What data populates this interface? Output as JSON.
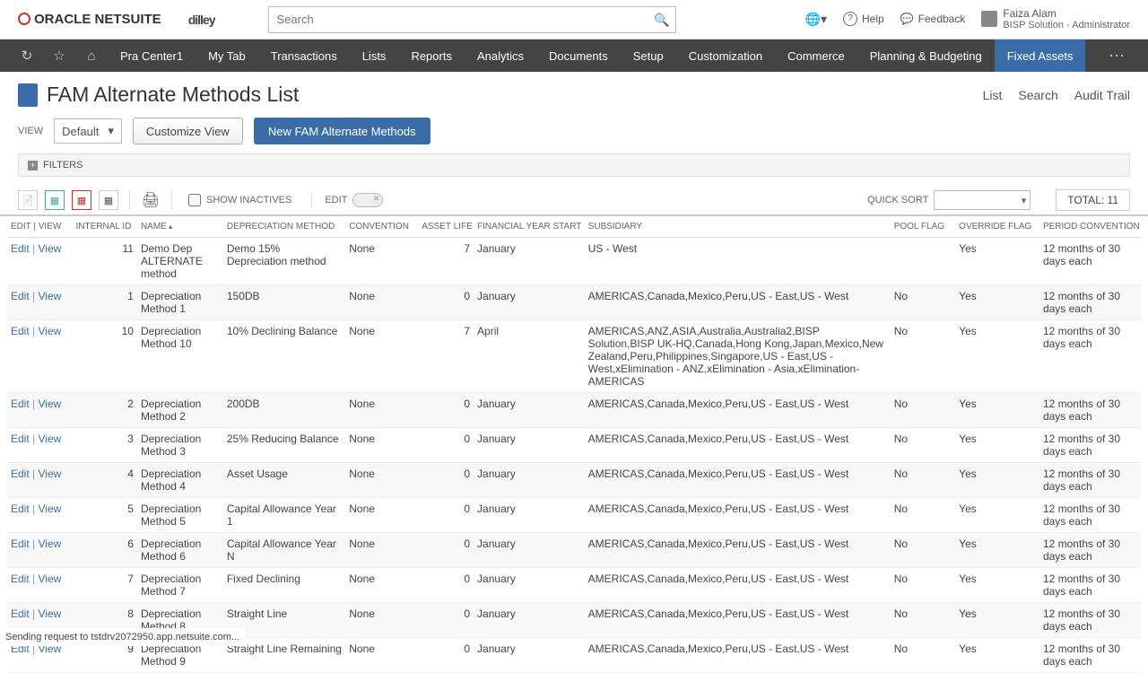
{
  "header": {
    "logo_main": "ORACLE NETSUITE",
    "logo_secondary": "dilley",
    "search_placeholder": "Search",
    "help_label": "Help",
    "feedback_label": "Feedback",
    "user_name": "Faiza Alam",
    "user_role": "BISP Solution - Administrator"
  },
  "nav": {
    "items": [
      "Pra Center1",
      "My Tab",
      "Transactions",
      "Lists",
      "Reports",
      "Analytics",
      "Documents",
      "Setup",
      "Customization",
      "Commerce",
      "Planning & Budgeting",
      "Fixed Assets"
    ],
    "active_index": 11
  },
  "page": {
    "title": "FAM Alternate Methods List",
    "right_links": [
      "List",
      "Search",
      "Audit Trail"
    ]
  },
  "controls": {
    "view_label": "VIEW",
    "view_value": "Default",
    "customize_label": "Customize View",
    "new_label": "New FAM Alternate Methods"
  },
  "filters": {
    "label": "FILTERS"
  },
  "toolbar": {
    "show_inactives_label": "SHOW INACTIVES",
    "edit_label": "EDIT",
    "quick_sort_label": "QUICK SORT",
    "total_label": "TOTAL: 11"
  },
  "table": {
    "columns": [
      "EDIT | VIEW",
      "INTERNAL ID",
      "NAME",
      "DEPRECIATION METHOD",
      "CONVENTION",
      "ASSET LIFE",
      "FINANCIAL YEAR START",
      "SUBSIDIARY",
      "POOL FLAG",
      "OVERRIDE FLAG",
      "PERIOD CONVENTION"
    ],
    "edit_label": "Edit",
    "view_label": "View",
    "rows": [
      {
        "id": "11",
        "name": "Demo Dep ALTERNATE method",
        "dep": "Demo 15% Depreciation method",
        "conv": "None",
        "life": "7",
        "fys": "January",
        "sub": "US - West",
        "pool": "",
        "over": "Yes",
        "per": "12 months of 30 days each"
      },
      {
        "id": "1",
        "name": "Depreciation Method 1",
        "dep": "150DB",
        "conv": "None",
        "life": "0",
        "fys": "January",
        "sub": "AMERICAS,Canada,Mexico,Peru,US - East,US - West",
        "pool": "No",
        "over": "Yes",
        "per": "12 months of 30 days each"
      },
      {
        "id": "10",
        "name": "Depreciation Method 10",
        "dep": "10% Declining Balance",
        "conv": "None",
        "life": "7",
        "fys": "April",
        "sub": "AMERICAS,ANZ,ASIA,Australia,Australia2,BISP Solution,BISP UK-HQ,Canada,Hong Kong,Japan,Mexico,New Zealand,Peru,Philippines,Singapore,US - East,US - West,xElimination - ANZ,xElimination - Asia,xElimination-AMERICAS",
        "pool": "No",
        "over": "Yes",
        "per": "12 months of 30 days each"
      },
      {
        "id": "2",
        "name": "Depreciation Method 2",
        "dep": "200DB",
        "conv": "None",
        "life": "0",
        "fys": "January",
        "sub": "AMERICAS,Canada,Mexico,Peru,US - East,US - West",
        "pool": "No",
        "over": "Yes",
        "per": "12 months of 30 days each"
      },
      {
        "id": "3",
        "name": "Depreciation Method 3",
        "dep": "25% Reducing Balance",
        "conv": "None",
        "life": "0",
        "fys": "January",
        "sub": "AMERICAS,Canada,Mexico,Peru,US - East,US - West",
        "pool": "No",
        "over": "Yes",
        "per": "12 months of 30 days each"
      },
      {
        "id": "4",
        "name": "Depreciation Method 4",
        "dep": "Asset Usage",
        "conv": "None",
        "life": "0",
        "fys": "January",
        "sub": "AMERICAS,Canada,Mexico,Peru,US - East,US - West",
        "pool": "No",
        "over": "Yes",
        "per": "12 months of 30 days each"
      },
      {
        "id": "5",
        "name": "Depreciation Method 5",
        "dep": "Capital Allowance Year 1",
        "conv": "None",
        "life": "0",
        "fys": "January",
        "sub": "AMERICAS,Canada,Mexico,Peru,US - East,US - West",
        "pool": "No",
        "over": "Yes",
        "per": "12 months of 30 days each"
      },
      {
        "id": "6",
        "name": "Depreciation Method 6",
        "dep": "Capital Allowance Year N",
        "conv": "None",
        "life": "0",
        "fys": "January",
        "sub": "AMERICAS,Canada,Mexico,Peru,US - East,US - West",
        "pool": "No",
        "over": "Yes",
        "per": "12 months of 30 days each"
      },
      {
        "id": "7",
        "name": "Depreciation Method 7",
        "dep": "Fixed Declining",
        "conv": "None",
        "life": "0",
        "fys": "January",
        "sub": "AMERICAS,Canada,Mexico,Peru,US - East,US - West",
        "pool": "No",
        "over": "Yes",
        "per": "12 months of 30 days each"
      },
      {
        "id": "8",
        "name": "Depreciation Method 8",
        "dep": "Straight Line",
        "conv": "None",
        "life": "0",
        "fys": "January",
        "sub": "AMERICAS,Canada,Mexico,Peru,US - East,US - West",
        "pool": "No",
        "over": "Yes",
        "per": "12 months of 30 days each"
      },
      {
        "id": "9",
        "name": "Depreciation Method 9",
        "dep": "Straight Line Remaining",
        "conv": "None",
        "life": "0",
        "fys": "January",
        "sub": "AMERICAS,Canada,Mexico,Peru,US - East,US - West",
        "pool": "No",
        "over": "Yes",
        "per": "12 months of 30 days each"
      }
    ]
  },
  "status": {
    "text": "Sending request to tstdrv2072950.app.netsuite.com..."
  }
}
